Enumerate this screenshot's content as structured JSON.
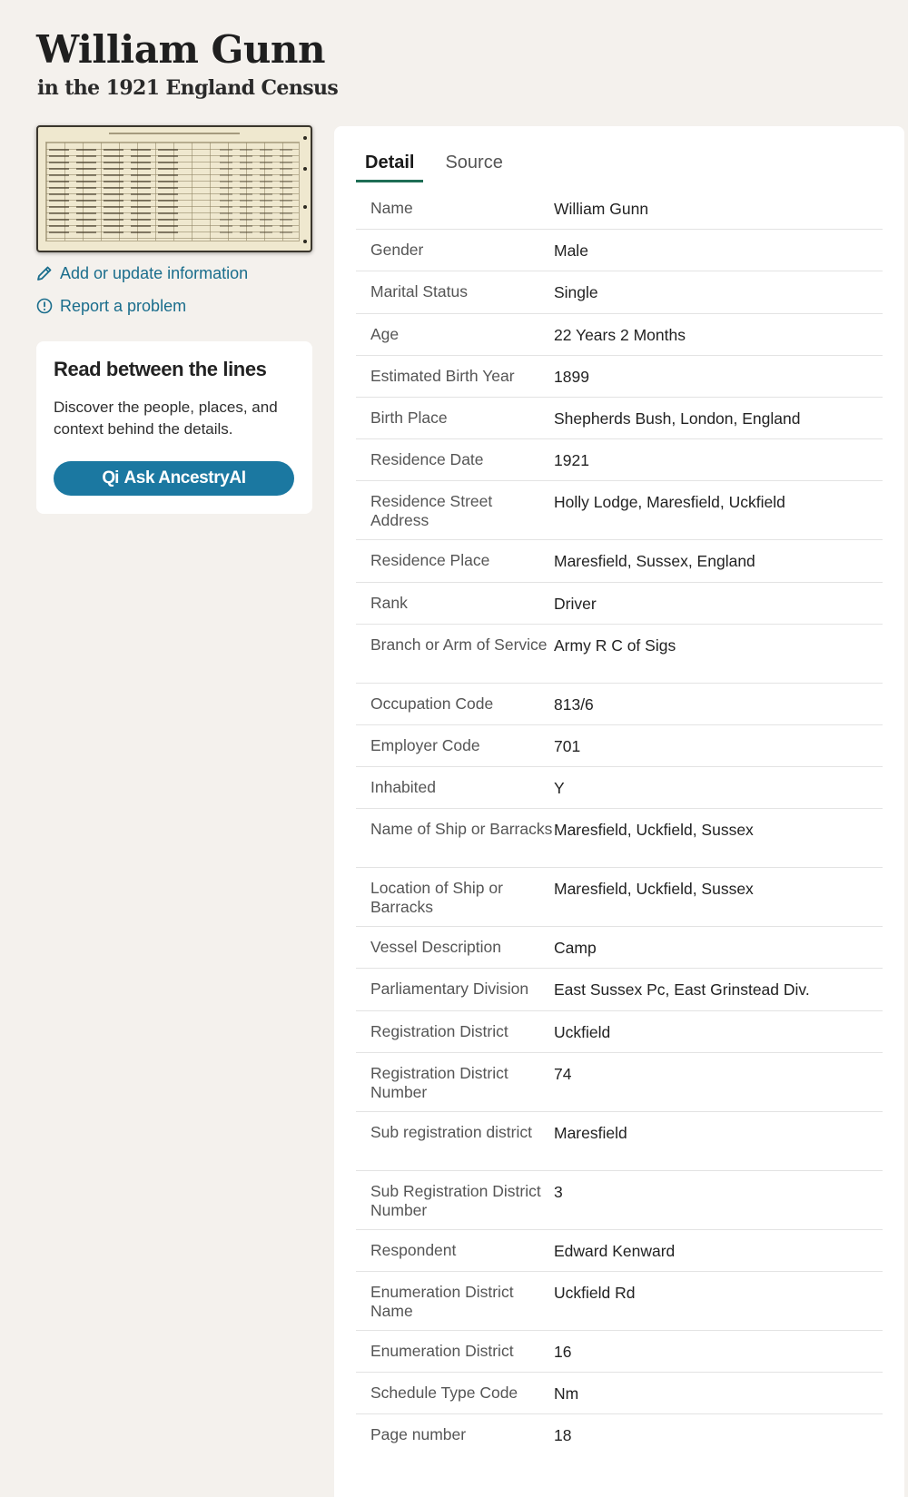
{
  "page": {
    "title": "William Gunn",
    "subtitle": "in the 1921 England Census"
  },
  "sidebar": {
    "add_update_label": "Add or update information",
    "report_label": "Report a problem",
    "promo": {
      "title": "Read between the lines",
      "text": "Discover the people, places, and context behind the details.",
      "button_icon": "Qi",
      "button_label": "Ask AncestryAI"
    }
  },
  "tabs": [
    {
      "label": "Detail",
      "active": true
    },
    {
      "label": "Source",
      "active": false
    }
  ],
  "details": [
    {
      "label": "Name",
      "value": "William Gunn"
    },
    {
      "label": "Gender",
      "value": "Male"
    },
    {
      "label": "Marital Status",
      "value": "Single"
    },
    {
      "label": "Age",
      "value": "22 Years 2 Months"
    },
    {
      "label": "Estimated Birth Year",
      "value": "1899"
    },
    {
      "label": "Birth Place",
      "value": "Shepherds Bush, London, England"
    },
    {
      "label": "Residence Date",
      "value": "1921"
    },
    {
      "label": "Residence Street Address",
      "value": "Holly Lodge, Maresfield, Uckfield"
    },
    {
      "label": "Residence Place",
      "value": "Maresfield, Sussex, England"
    },
    {
      "label": "Rank",
      "value": "Driver"
    },
    {
      "label": "Branch or Arm of Service",
      "value": "Army R C of Sigs"
    },
    {
      "label": "Occupation Code",
      "value": "813/6"
    },
    {
      "label": "Employer Code",
      "value": "701"
    },
    {
      "label": "Inhabited",
      "value": "Y"
    },
    {
      "label": "Name of Ship or Barracks",
      "value": "Maresfield, Uckfield, Sussex"
    },
    {
      "label": "Location of Ship or Barracks",
      "value": "Maresfield, Uckfield, Sussex"
    },
    {
      "label": "Vessel Description",
      "value": "Camp"
    },
    {
      "label": "Parliamentary Division",
      "value": "East Sussex Pc, East Grinstead Div."
    },
    {
      "label": "Registration District",
      "value": "Uckfield"
    },
    {
      "label": "Registration District Number",
      "value": "74"
    },
    {
      "label": "Sub registration district",
      "value": "Maresfield"
    },
    {
      "label": "Sub Registration District Number",
      "value": "3"
    },
    {
      "label": "Respondent",
      "value": "Edward Kenward"
    },
    {
      "label": "Enumeration District Name",
      "value": "Uckfield Rd"
    },
    {
      "label": "Enumeration District",
      "value": "16"
    },
    {
      "label": "Schedule Type Code",
      "value": "Nm"
    },
    {
      "label": "Page number",
      "value": "18"
    }
  ],
  "colors": {
    "background": "#f4f1ed",
    "link": "#1a6d8c",
    "button": "#1b78a1",
    "tab_underline": "#1e6e55"
  }
}
